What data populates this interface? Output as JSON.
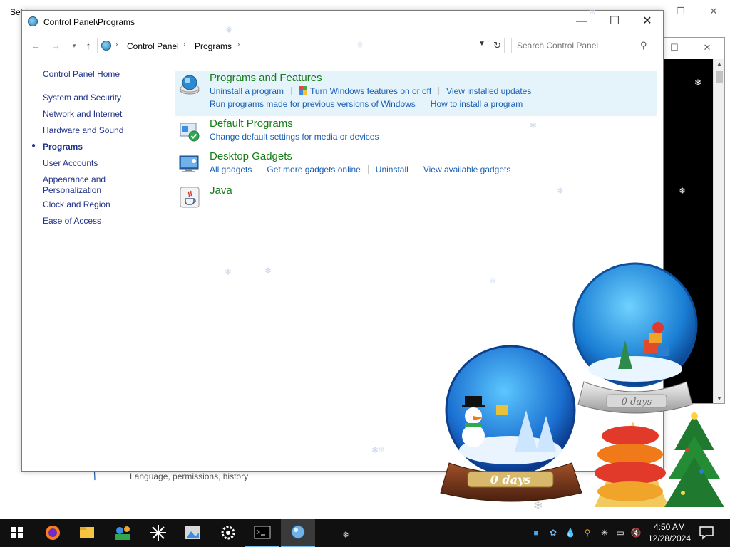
{
  "background_window": {
    "title": "Settings",
    "subtitle": "Language, permissions, history"
  },
  "window": {
    "title": "Control Panel\\Programs"
  },
  "address_bar": {
    "crumbs": [
      "Control Panel",
      "Programs"
    ]
  },
  "search": {
    "placeholder": "Search Control Panel"
  },
  "sidebar": {
    "items": [
      {
        "label": "Control Panel Home"
      },
      {
        "label": "System and Security"
      },
      {
        "label": "Network and Internet"
      },
      {
        "label": "Hardware and Sound"
      },
      {
        "label": "Programs",
        "active": true
      },
      {
        "label": "User Accounts"
      },
      {
        "label": "Appearance and Personalization"
      },
      {
        "label": "Clock and Region"
      },
      {
        "label": "Ease of Access"
      }
    ]
  },
  "categories": [
    {
      "title": "Programs and Features",
      "icon": "programs-features-icon",
      "links": [
        "Uninstall a program",
        "Turn Windows features on or off",
        "View installed updates",
        "Run programs made for previous versions of Windows",
        "How to install a program"
      ]
    },
    {
      "title": "Default Programs",
      "icon": "default-programs-icon",
      "links": [
        "Change default settings for media or devices"
      ]
    },
    {
      "title": "Desktop Gadgets",
      "icon": "gadgets-icon",
      "links": [
        "All gadgets",
        "Get more gadgets online",
        "Uninstall",
        "View available gadgets"
      ]
    },
    {
      "title": "Java",
      "icon": "java-icon",
      "links": []
    }
  ],
  "desktop_widgets": {
    "globe_left_label": "0 days",
    "globe_right_label": "0 days"
  },
  "taskbar": {
    "apps": [
      "start-icon",
      "firefox-icon",
      "file-explorer-icon",
      "app-icon",
      "snow-app-icon",
      "photos-icon",
      "settings-icon",
      "terminal-icon",
      "control-panel-icon"
    ],
    "time": "4:50 AM",
    "date": "12/28/2024"
  },
  "colors": {
    "link": "#1a5fb4",
    "category_title": "#187d18",
    "left_nav": "#1e3287",
    "highlight": "#e5f3fb",
    "taskbar": "#101010"
  }
}
